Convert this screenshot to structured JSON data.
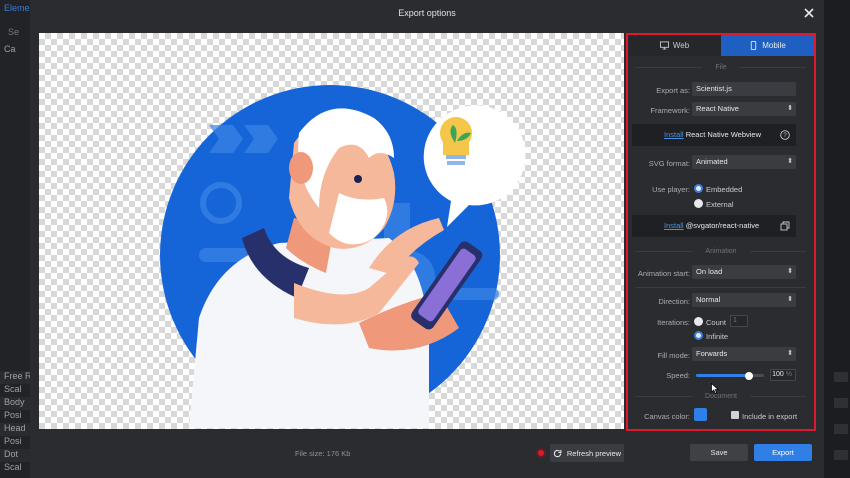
{
  "background": {
    "tab": "Element",
    "search": "Se",
    "rows": [
      "Ca",
      "Free R",
      "Scal",
      "Body",
      "Posi",
      "Head",
      "Posi",
      "Dot",
      "Scal"
    ]
  },
  "modal": {
    "title": "Export options"
  },
  "tabs": {
    "web": "Web",
    "mobile": "Mobile"
  },
  "file": {
    "section_title": "File",
    "export_as_label": "Export as:",
    "export_as_value": "Scientist.js",
    "framework_label": "Framework:",
    "framework_value": "React Native",
    "install_link": "Install",
    "install_webview": "React Native Webview",
    "svg_format_label": "SVG format:",
    "svg_format_value": "Animated",
    "use_player_label": "Use player:",
    "player_embedded": "Embedded",
    "player_external": "External",
    "install_link2": "Install",
    "install_svgator": "@svgator/react-native"
  },
  "animation": {
    "section_title": "Animation",
    "start_label": "Animation start:",
    "start_value": "On load",
    "direction_label": "Direction:",
    "direction_value": "Normal",
    "iterations_label": "Iterations:",
    "iter_count": "Count",
    "iter_count_value": "1",
    "iter_infinite": "Infinite",
    "fill_mode_label": "Fill mode:",
    "fill_mode_value": "Forwards",
    "speed_label": "Speed:",
    "speed_value": "100",
    "speed_unit": "%",
    "speed_fraction": 0.78
  },
  "document": {
    "section_title": "Document",
    "canvas_color_label": "Canvas color:",
    "canvas_color": "#2f7fe6",
    "include_label": "Include in export"
  },
  "footer": {
    "file_size": "File size: 176 Kb",
    "refresh": "Refresh preview",
    "save": "Save",
    "export": "Export"
  }
}
